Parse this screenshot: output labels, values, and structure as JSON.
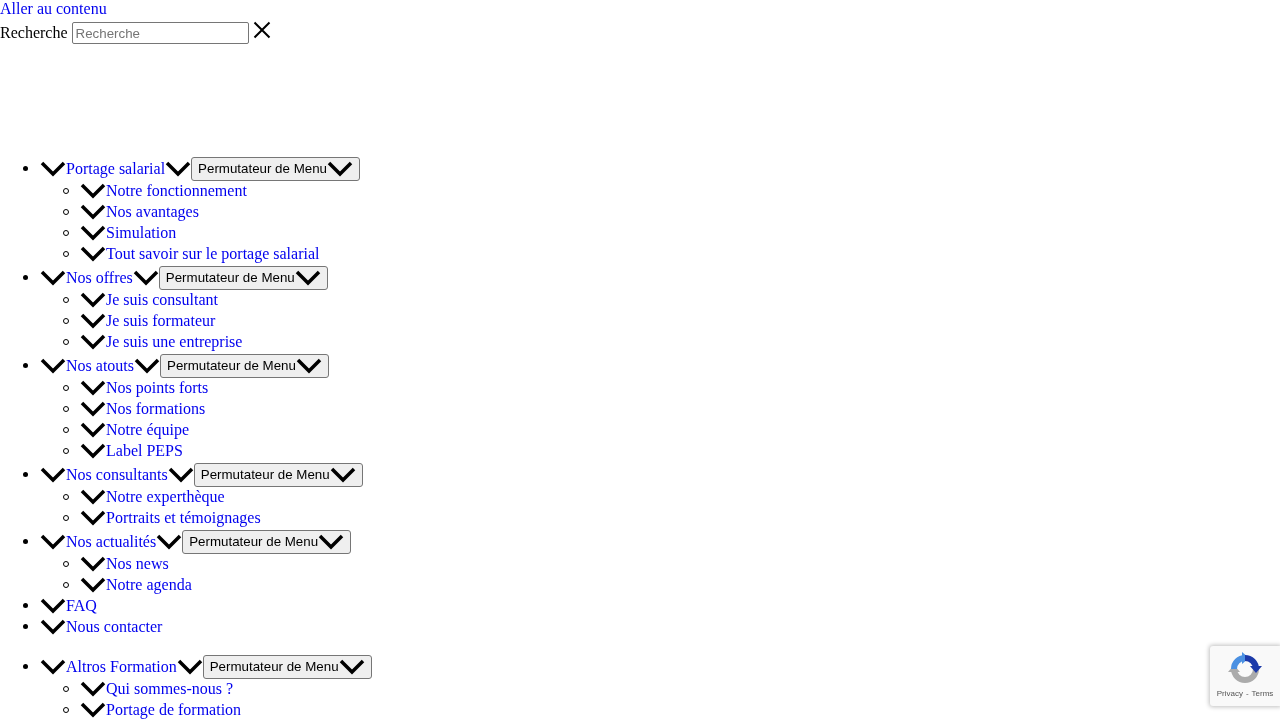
{
  "skip_link": "Aller au contenu",
  "search": {
    "label": "Recherche",
    "placeholder": "Recherche"
  },
  "menus": [
    {
      "items": [
        {
          "label": "Portage salarial",
          "toggle": "Permutateur de Menu",
          "children": [
            {
              "label": "Notre fonctionnement"
            },
            {
              "label": "Nos avantages"
            },
            {
              "label": "Simulation"
            },
            {
              "label": "Tout savoir sur le portage salarial"
            }
          ]
        },
        {
          "label": "Nos offres",
          "toggle": "Permutateur de Menu",
          "children": [
            {
              "label": "Je suis consultant"
            },
            {
              "label": "Je suis formateur"
            },
            {
              "label": "Je suis une entreprise"
            }
          ]
        },
        {
          "label": "Nos atouts",
          "toggle": "Permutateur de Menu",
          "children": [
            {
              "label": "Nos points forts"
            },
            {
              "label": "Nos formations"
            },
            {
              "label": "Notre équipe"
            },
            {
              "label": "Label PEPS"
            }
          ]
        },
        {
          "label": "Nos consultants",
          "toggle": "Permutateur de Menu",
          "children": [
            {
              "label": "Notre experthèque"
            },
            {
              "label": "Portraits et témoignages"
            }
          ]
        },
        {
          "label": "Nos actualités",
          "toggle": "Permutateur de Menu",
          "children": [
            {
              "label": "Nos news"
            },
            {
              "label": "Notre agenda"
            }
          ]
        },
        {
          "label": "FAQ"
        },
        {
          "label": "Nous contacter"
        }
      ]
    },
    {
      "items": [
        {
          "label": "Altros Formation",
          "toggle": "Permutateur de Menu",
          "children": [
            {
              "label": "Qui sommes-nous ?"
            },
            {
              "label": "Portage de formation"
            }
          ]
        }
      ]
    }
  ],
  "recaptcha": {
    "links": [
      "Privacy",
      "Terms"
    ],
    "separator": "-"
  }
}
